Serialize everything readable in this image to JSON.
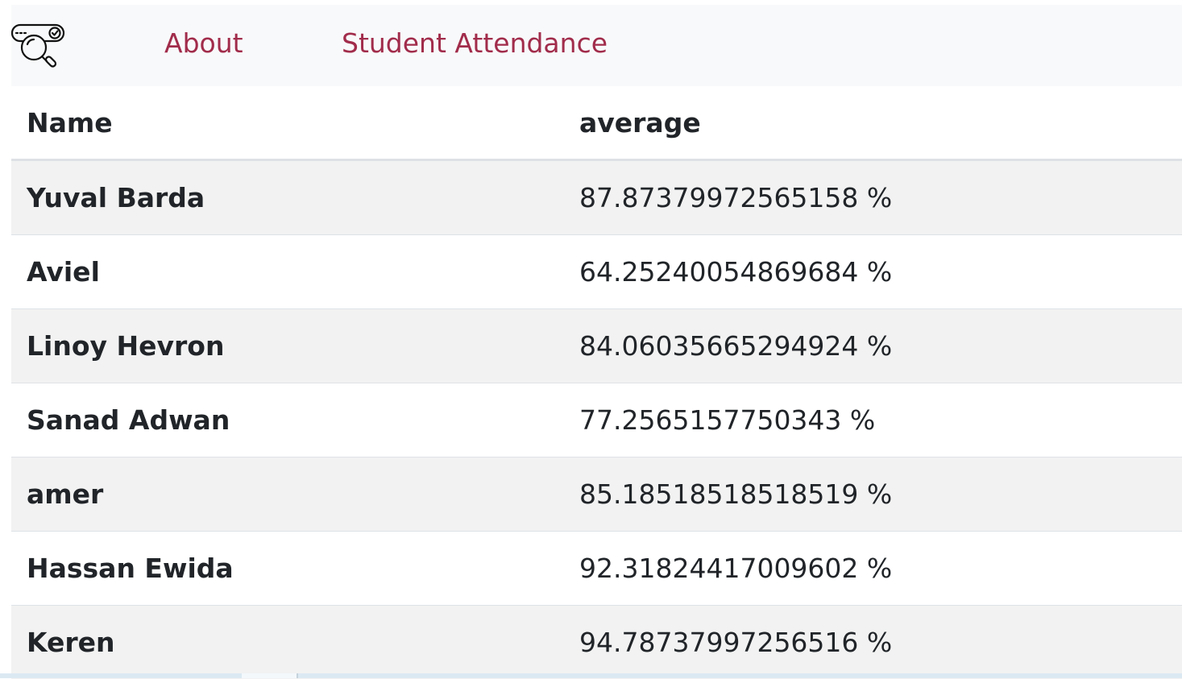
{
  "nav": {
    "logo_icon": "attendance-search-icon",
    "links": [
      {
        "label": "About"
      },
      {
        "label": "Student Attendance"
      }
    ],
    "link_color": "#a12c4b"
  },
  "table": {
    "headers": {
      "name": "Name",
      "average": "average"
    },
    "rows": [
      {
        "name": "Yuval Barda",
        "average": "87.87379972565158 %"
      },
      {
        "name": "Aviel",
        "average": "64.25240054869684 %"
      },
      {
        "name": "Linoy Hevron",
        "average": "84.06035665294924 %"
      },
      {
        "name": "Sanad Adwan",
        "average": "77.2565157750343 %"
      },
      {
        "name": "amer",
        "average": "85.18518518518519 %"
      },
      {
        "name": "Hassan Ewida",
        "average": "92.31824417009602 %"
      },
      {
        "name": "Keren",
        "average": "94.78737997256516 %"
      }
    ]
  }
}
